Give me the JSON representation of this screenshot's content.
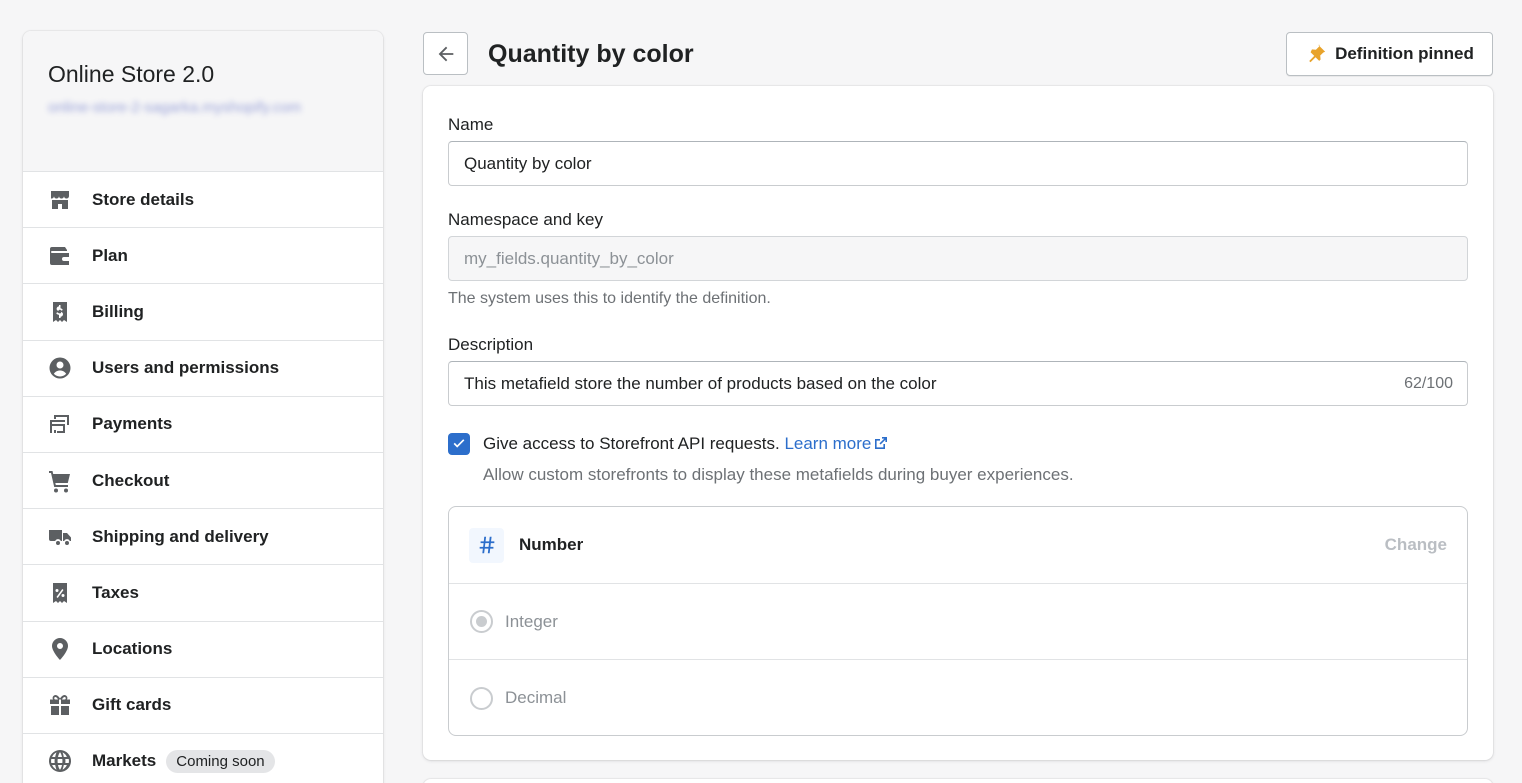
{
  "sidebar": {
    "store_name": "Online Store 2.0",
    "store_url": "online-store-2-sagarka.myshopify.com",
    "items": [
      {
        "label": "Store details",
        "icon": "store-icon"
      },
      {
        "label": "Plan",
        "icon": "plan-icon"
      },
      {
        "label": "Billing",
        "icon": "billing-icon"
      },
      {
        "label": "Users and permissions",
        "icon": "user-icon"
      },
      {
        "label": "Payments",
        "icon": "payments-icon"
      },
      {
        "label": "Checkout",
        "icon": "cart-icon"
      },
      {
        "label": "Shipping and delivery",
        "icon": "truck-icon"
      },
      {
        "label": "Taxes",
        "icon": "taxes-icon"
      },
      {
        "label": "Locations",
        "icon": "location-icon"
      },
      {
        "label": "Gift cards",
        "icon": "gift-icon"
      },
      {
        "label": "Markets",
        "icon": "globe-icon",
        "badge": "Coming soon"
      }
    ]
  },
  "header": {
    "title": "Quantity by color",
    "pin_label": "Definition pinned"
  },
  "form": {
    "name_label": "Name",
    "name_value": "Quantity by color",
    "namespace_label": "Namespace and key",
    "namespace_value": "my_fields.quantity_by_color",
    "namespace_help": "The system uses this to identify the definition.",
    "description_label": "Description",
    "description_value": "This metafield store the number of products based on the color",
    "description_count": "62/100",
    "storefront_label": "Give access to Storefront API requests.",
    "storefront_link": "Learn more",
    "storefront_help": "Allow custom storefronts to display these metafields during buyer experiences.",
    "storefront_checked": true
  },
  "type": {
    "name": "Number",
    "change_label": "Change",
    "options": [
      {
        "label": "Integer",
        "selected": true
      },
      {
        "label": "Decimal",
        "selected": false
      }
    ]
  },
  "colors": {
    "accent": "#2c6ecb",
    "pin": "#e8a32b"
  }
}
